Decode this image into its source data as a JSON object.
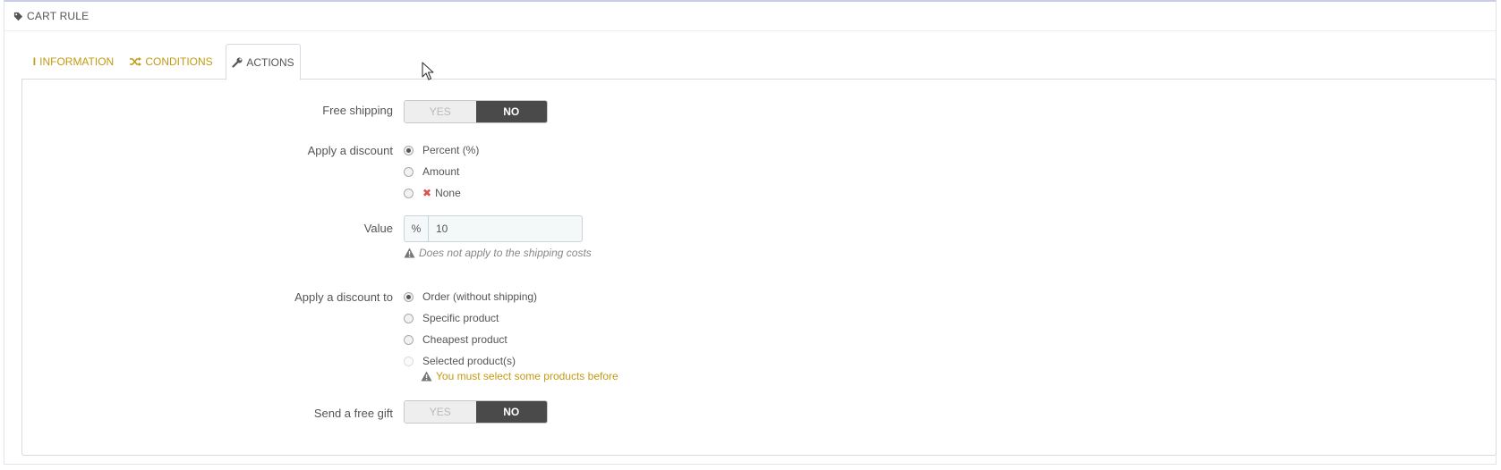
{
  "panel": {
    "title": "CART RULE",
    "icon": "tag-icon"
  },
  "tabs": [
    {
      "label": "INFORMATION",
      "icon": "info-icon",
      "active": false
    },
    {
      "label": "CONDITIONS",
      "icon": "shuffle-icon",
      "active": false
    },
    {
      "label": "ACTIONS",
      "icon": "wrench-icon",
      "active": true
    }
  ],
  "free_shipping": {
    "label": "Free shipping",
    "yes": "YES",
    "no": "NO",
    "selected": "NO"
  },
  "apply_discount": {
    "label": "Apply a discount",
    "options": [
      "Percent (%)",
      "Amount",
      "None"
    ],
    "selected": "Percent (%)"
  },
  "value": {
    "label": "Value",
    "prefix": "%",
    "input": "10",
    "help": "Does not apply to the shipping costs"
  },
  "apply_discount_to": {
    "label": "Apply a discount to",
    "options": [
      "Order (without shipping)",
      "Specific product",
      "Cheapest product",
      "Selected product(s)"
    ],
    "selected": "Order (without shipping)",
    "warning": "You must select some products before"
  },
  "free_gift": {
    "label": "Send a free gift",
    "yes": "YES",
    "no": "NO",
    "selected": "NO"
  },
  "colors": {
    "accent": "#c49a12",
    "switch_on": "#4a4a4a",
    "danger": "#d9534f"
  }
}
